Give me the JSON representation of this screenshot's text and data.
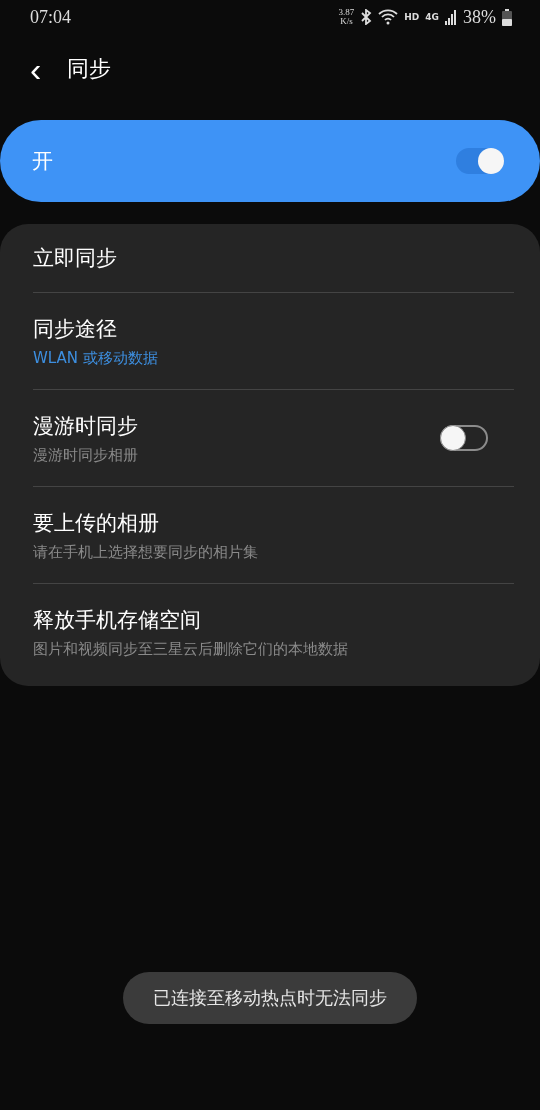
{
  "status_bar": {
    "time": "07:04",
    "speed": "3.87",
    "speed_unit": "K/s",
    "hd": "HD",
    "network": "4G",
    "battery": "38%"
  },
  "header": {
    "back": "‹",
    "title": "同步"
  },
  "master_switch": {
    "label": "开",
    "on": true
  },
  "items": [
    {
      "kind": "action",
      "title": "立即同步"
    },
    {
      "kind": "choice",
      "title": "同步途径",
      "subtitle": "WLAN 或移动数据"
    },
    {
      "kind": "switch",
      "title": "漫游时同步",
      "subtitle": "漫游时同步相册",
      "on": false
    },
    {
      "kind": "detail",
      "title": "要上传的相册",
      "subtitle": "请在手机上选择想要同步的相片集"
    },
    {
      "kind": "detail",
      "title": "释放手机存储空间",
      "subtitle": "图片和视频同步至三星云后删除它们的本地数据"
    }
  ],
  "toast": "已连接至移动热点时无法同步"
}
